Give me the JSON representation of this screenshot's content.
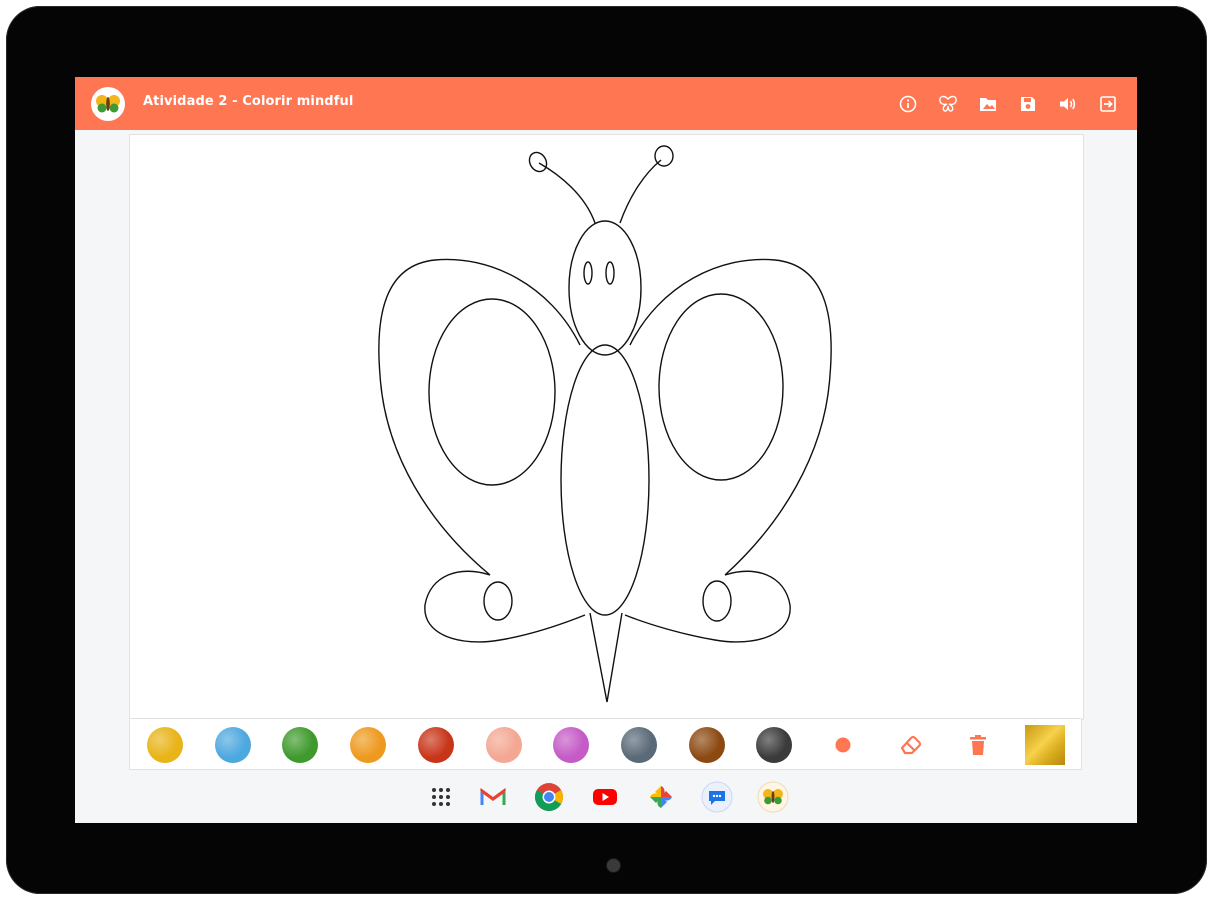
{
  "app": {
    "title": "Atividade 2 - Colorir mindful",
    "accent": "#ff7652"
  },
  "toolbar": {
    "icons": [
      "info-icon",
      "butterfly-icon",
      "folder-image-icon",
      "save-icon",
      "volume-icon",
      "exit-icon"
    ]
  },
  "palette": {
    "colors": [
      "#e8b418",
      "#4ea8e0",
      "#3f9a2d",
      "#ee9a1f",
      "#c8361a",
      "#f4a793",
      "#c45bc6",
      "#5b6a78",
      "#8c4a12",
      "#3b3b3b"
    ],
    "tools": [
      "brush-dot-icon",
      "eraser-icon",
      "trash-icon"
    ],
    "tool_color": "#ff7652"
  },
  "shelf": {
    "apps": [
      "launcher-icon",
      "gmail-icon",
      "chrome-icon",
      "youtube-icon",
      "photos-icon",
      "messages-icon",
      "butterfly-app-icon"
    ]
  }
}
